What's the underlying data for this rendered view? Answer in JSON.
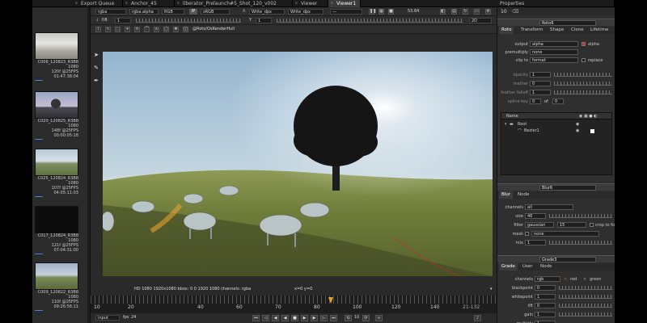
{
  "tabs": [
    {
      "label": "Export Queue"
    },
    {
      "label": "Anchor_45"
    },
    {
      "label": "liberator_Prelaunch#5_Shot_120_v002"
    },
    {
      "label": "Viewer"
    },
    {
      "label": "Viewer1"
    },
    {
      "label": "Properties"
    }
  ],
  "bin": {
    "clips": [
      {
        "name": "C006_120823_R3B8",
        "res": "1080",
        "meta1": "120f @25FPS",
        "meta2": "01:47:38:04"
      },
      {
        "name": "C020_120825_R3B8",
        "res": "1080",
        "meta1": "148f @25FPS",
        "meta2": "00:00:05:18"
      },
      {
        "name": "C025_120824_R3B8",
        "res": "1080",
        "meta1": "107f @25FPS",
        "meta2": "04:05:11:03"
      },
      {
        "name": "C017_120824_R3B8",
        "res": "1080",
        "meta1": "121f @25FPS",
        "meta2": "07:04:31:00"
      },
      {
        "name": "C009_120822_R3B8",
        "res": "1080",
        "meta1": "110f @25FPS",
        "meta2": "09:26:56:11"
      }
    ]
  },
  "viewer": {
    "channel_set": "rgba",
    "alpha_channel": "rgba.alpha",
    "colorspace_a": "RGB",
    "ip_label": "IP",
    "colorspace_b": "sRGB",
    "input_a": "Write_dpx",
    "input_b": "Write_dpx",
    "fps_display": "53.64",
    "frame_label": "f/8",
    "frame_value": "1",
    "y_label": "Y",
    "y_value": "1",
    "view_mode": "2D",
    "roto_path": "@Roto/OsRenderHull",
    "status_text": "HD 1080 1920x1080  bbox: 0 0 1920 1080 channels: rgba",
    "coords": "x=0 y=0",
    "timeline_ticks": [
      "10",
      "20",
      "40",
      "60",
      "70",
      "80",
      "100",
      "120",
      "140"
    ],
    "range_label": "21-132",
    "input_mode": "Input",
    "fps_label": "fps",
    "fps_value": "24",
    "step_value": "10"
  },
  "props": {
    "panel_count": "10",
    "roto": {
      "name": "Roto6",
      "tabs": [
        "Roto",
        "Transform",
        "Shape",
        "Clone",
        "Lifetime"
      ],
      "output_label": "output",
      "output_value": "alpha",
      "output_check": "alpha",
      "premultiply_label": "premultiply",
      "premultiply_value": "none",
      "clip_label": "clip to",
      "clip_value": "format",
      "clip_check": "replace",
      "opacity_label": "opacity",
      "opacity_value": "1",
      "feather_label": "feather",
      "feather_value": "0",
      "falloff_label": "feather falloff",
      "falloff_value": "1",
      "spline_label": "spline key",
      "spline_value": "0",
      "spline_of": "of",
      "spline_total": "0",
      "tree_header": "Name",
      "tree_root": "Root",
      "tree_child": "Bezier1"
    },
    "blur": {
      "name": "Blur6",
      "tabs": [
        "Blur",
        "Node"
      ],
      "channels_label": "channels",
      "channels_value": "all",
      "size_label": "size",
      "size_value": "46",
      "filter_label": "filter",
      "filter_value": "gaussian",
      "filter_quality": "15",
      "crop_label": "crop to fo",
      "mask_label": "mask",
      "mask_value": "none",
      "mix_label": "mix",
      "mix_value": "1"
    },
    "grade": {
      "name": "Grade3",
      "tabs": [
        "Grade",
        "User",
        "Node"
      ],
      "channels_label": "channels",
      "channels_value": "rgb",
      "red_label": "red",
      "green_label": "green",
      "blackpoint_label": "blackpoint",
      "blackpoint_value": "0",
      "whitepoint_label": "whitepoint",
      "whitepoint_value": "1",
      "lift_label": "lift",
      "lift_value": "0",
      "gain_label": "gain",
      "gain_value": "1",
      "multiply_label": "multiply",
      "multiply_value": "1"
    }
  },
  "colors": {
    "accent": "#e8a030",
    "selection_blue": "#4a7fd6",
    "background": "#262626"
  }
}
